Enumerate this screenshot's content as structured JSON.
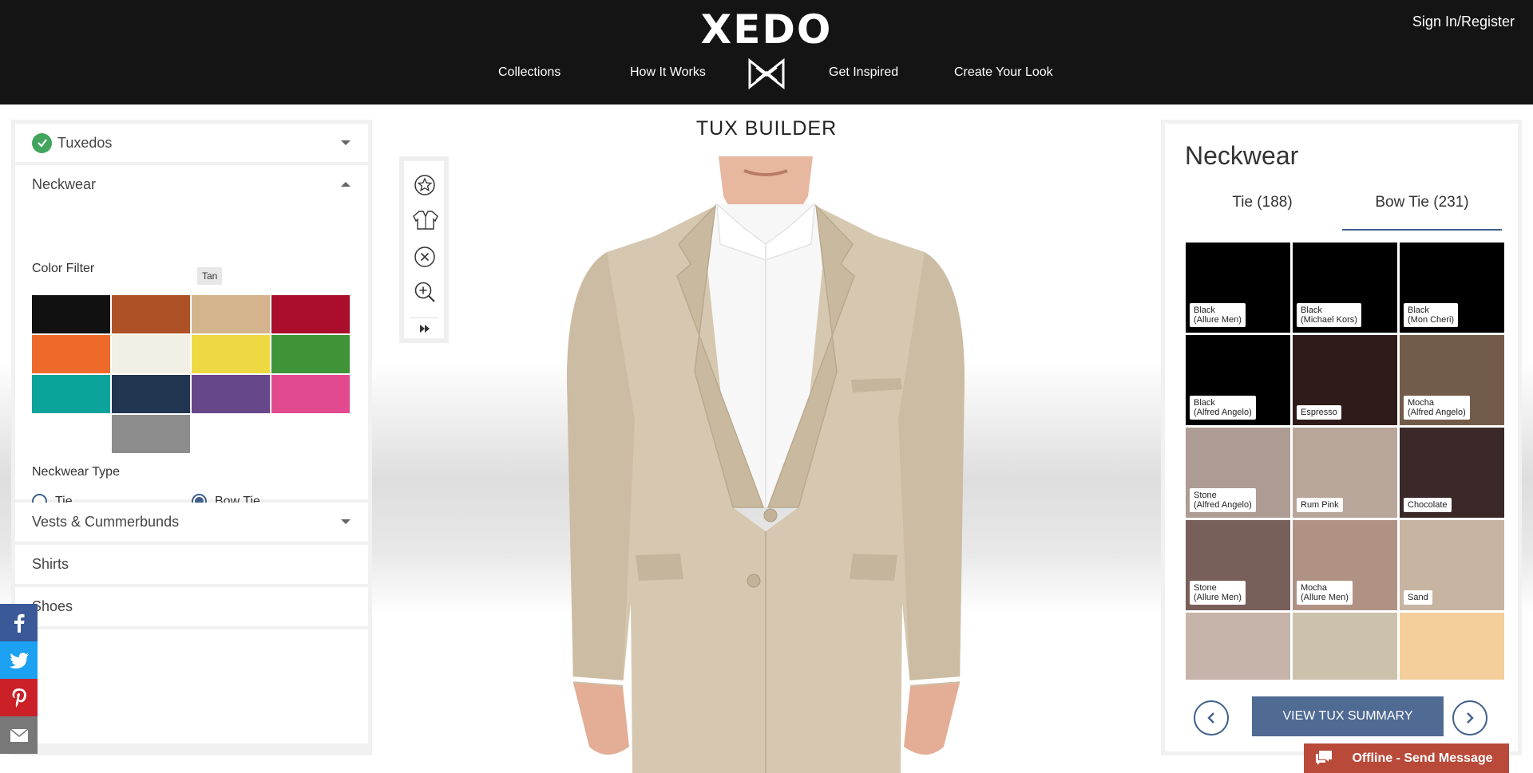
{
  "header": {
    "logo": "XEDO",
    "sign_in": "Sign In/Register",
    "nav": [
      "Collections",
      "How It Works",
      "Get Inspired",
      "Create Your Look"
    ]
  },
  "builder_title": "TUX BUILDER",
  "left_panel": {
    "sections": {
      "tuxedos": "Tuxedos",
      "neckwear": "Neckwear",
      "vests": "Vests & Cummerbunds",
      "shirts": "Shirts",
      "shoes": "Shoes"
    },
    "color_filter_label": "Color Filter",
    "tooltip": "Tan",
    "swatches": [
      {
        "name": "black",
        "color": "#111111"
      },
      {
        "name": "rust",
        "color": "#ad5226"
      },
      {
        "name": "tan",
        "color": "#d4b48c"
      },
      {
        "name": "burgundy",
        "color": "#aa0e2c"
      },
      {
        "name": "orange",
        "color": "#ee6a2b"
      },
      {
        "name": "ivory",
        "color": "#f1efe6"
      },
      {
        "name": "yellow",
        "color": "#efd943"
      },
      {
        "name": "green",
        "color": "#3f943a"
      },
      {
        "name": "teal",
        "color": "#0ca39a"
      },
      {
        "name": "navy",
        "color": "#1f3550"
      },
      {
        "name": "purple",
        "color": "#66478a"
      },
      {
        "name": "pink",
        "color": "#e24a8f"
      },
      {
        "name": "grey",
        "color": "#8c8c8c"
      }
    ],
    "neckwear_type_label": "Neckwear Type",
    "type_options": [
      "Tie",
      "Bow Tie"
    ],
    "selected_type": "Bow Tie"
  },
  "right_panel": {
    "title": "Neckwear",
    "tabs": [
      "Tie (188)",
      "Bow Tie (231)"
    ],
    "active_tab": "Bow Tie (231)",
    "tiles": [
      {
        "label": "Black\n(Allure Men)",
        "color": "#000000"
      },
      {
        "label": "Black\n(Michael Kors)",
        "color": "#000000"
      },
      {
        "label": "Black\n(Mon Cheri)",
        "color": "#000000"
      },
      {
        "label": "Black\n(Alfred Angelo)",
        "color": "#000000"
      },
      {
        "label": "Espresso",
        "color": "#2e1b1a"
      },
      {
        "label": "Mocha\n(Alfred Angelo)",
        "color": "#735b49"
      },
      {
        "label": "Stone\n(Alfred Angelo)",
        "color": "#ad9c93"
      },
      {
        "label": "Rum Pink",
        "color": "#b9a69a"
      },
      {
        "label": "Chocolate",
        "color": "#3b2929"
      },
      {
        "label": "Stone\n(Allure Men)",
        "color": "#785f59"
      },
      {
        "label": "Mocha\n(Allure Men)",
        "color": "#b09285"
      },
      {
        "label": "Sand",
        "color": "#c7b5a2"
      },
      {
        "label": "",
        "color": "#c6b3aa"
      },
      {
        "label": "",
        "color": "#cbc1ad"
      },
      {
        "label": "",
        "color": "#f4cf9c"
      }
    ],
    "summary_button": "VIEW TUX SUMMARY"
  },
  "chat": {
    "label": "Offline - Send Message"
  },
  "colors": {
    "header": "#141414",
    "accent": "#3f5f8c",
    "button": "#4f6a93",
    "suit": "#d6c8b0"
  }
}
